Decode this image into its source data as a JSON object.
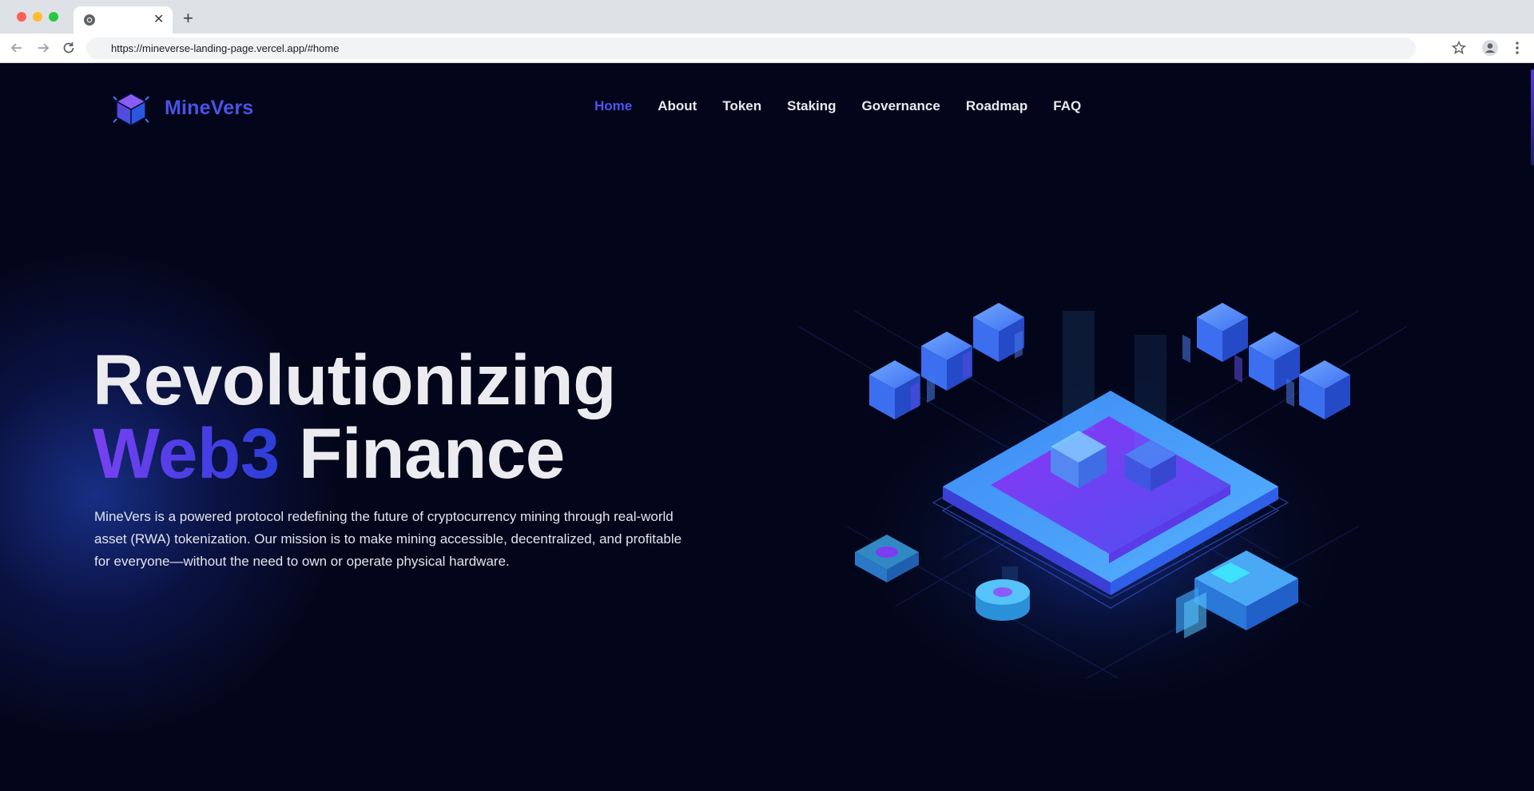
{
  "browser": {
    "url": "https://mineverse-landing-page.vercel.app/#home",
    "tab_close": "✕",
    "new_tab": "+"
  },
  "site": {
    "brand": "MineVers",
    "nav": [
      {
        "label": "Home",
        "active": true
      },
      {
        "label": "About"
      },
      {
        "label": "Token"
      },
      {
        "label": "Staking"
      },
      {
        "label": "Governance"
      },
      {
        "label": "Roadmap"
      },
      {
        "label": "FAQ"
      }
    ]
  },
  "hero": {
    "title_line1": "Revolutionizing",
    "title_accent": "Web3",
    "title_rest": " Finance",
    "description": "MineVers is a powered protocol redefining the future of cryptocurrency mining through real-world asset (RWA) tokenization. Our mission is to make mining accessible, decentralized, and profitable for everyone—without the need to own or operate physical hardware."
  },
  "colors": {
    "background": "#03061a",
    "accent": "#4f53f0",
    "accent_purple": "#7a40f2"
  }
}
